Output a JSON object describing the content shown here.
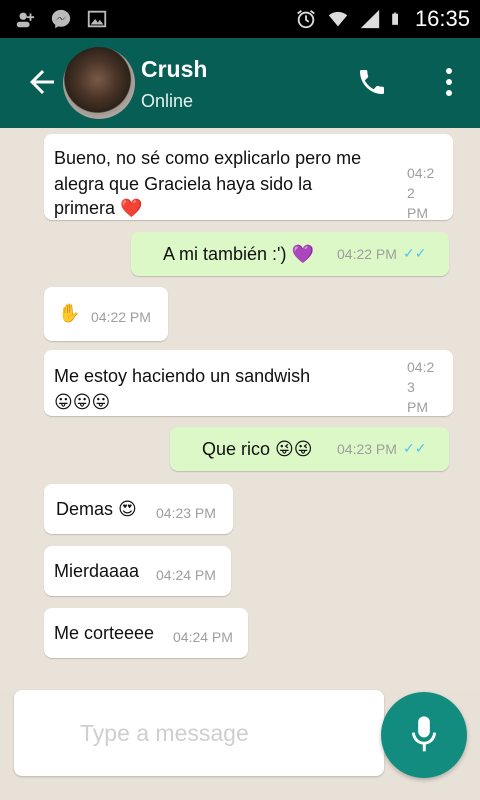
{
  "status_bar": {
    "time": "16:35",
    "left_icons": [
      "add-contact-icon",
      "messenger-icon",
      "image-icon"
    ],
    "right_icons": [
      "alarm-icon",
      "wifi-icon",
      "signal-icon",
      "battery-icon"
    ]
  },
  "header": {
    "contact_name": "Crush",
    "contact_status": "Online",
    "icons": [
      "back-arrow-icon",
      "avatar",
      "phone-icon",
      "more-vert-icon"
    ]
  },
  "messages": [
    {
      "direction": "in",
      "text_lines": [
        "Bueno, no sé como explicarlo pero me",
        "alegra que Graciela haya sido la",
        "primera ❤️"
      ],
      "time_lines": [
        "04:2",
        "2",
        "PM"
      ]
    },
    {
      "direction": "out",
      "text": "A mi también :') 💜",
      "time": "04:22 PM",
      "status": "read"
    },
    {
      "direction": "in",
      "text": "✋",
      "time": "04:22 PM"
    },
    {
      "direction": "in",
      "text_lines": [
        "Me estoy haciendo un sandwish",
        "😛😛😛"
      ],
      "time_lines": [
        "04:2",
        "3",
        "PM"
      ]
    },
    {
      "direction": "out",
      "text": "Que rico 😜😜",
      "time": "04:23 PM",
      "status": "read"
    },
    {
      "direction": "in",
      "text": "Demas 😍",
      "time": "04:23 PM"
    },
    {
      "direction": "in",
      "text": "Mierdaaaa",
      "time": "04:24 PM"
    },
    {
      "direction": "in",
      "text": "Me corteeee",
      "time": "04:24 PM"
    }
  ],
  "composer": {
    "placeholder": "Type a message",
    "mic_icon": "mic-icon"
  },
  "colors": {
    "header": "#075e54",
    "outgoing": "#dcf8c6",
    "incoming": "#ffffff",
    "fab": "#128c7e",
    "tick": "#4fc3f7"
  }
}
